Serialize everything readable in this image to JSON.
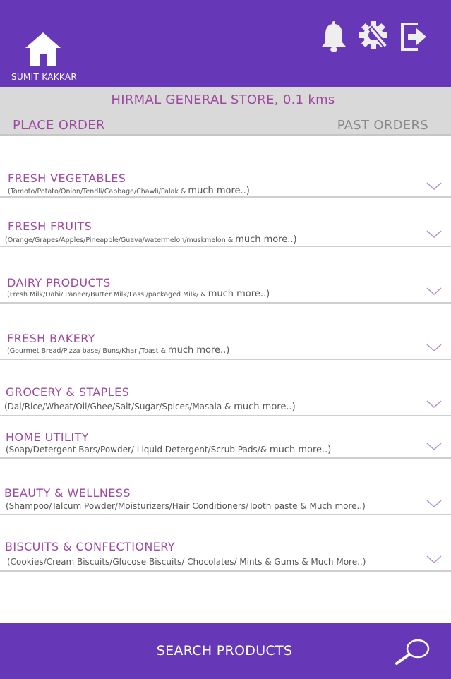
{
  "header": {
    "username": "SUMIT KAKKAR",
    "icons": {
      "home": "home-icon",
      "bell": "bell-icon",
      "settings": "gear-icon",
      "logout": "logout-icon"
    },
    "bg_color": "#6638b8"
  },
  "store": {
    "name": "HIRMAL GENERAL STORE, 0.1 kms",
    "tabs": {
      "place_order": "PLACE ORDER",
      "past_orders": "PAST ORDERS"
    },
    "active_tab": "place_order"
  },
  "categories": [
    {
      "title": "FRESH VEGETABLES",
      "desc": "(Tomoto/Potato/Onion/Tendli/Cabbage/Chawli/Palak & ",
      "more": "much more..)"
    },
    {
      "title": "FRESH FRUITS",
      "desc": "(Orange/Grapes/Apples/Pineapple/Guava/watermelon/muskmelon & ",
      "more": "much more..)"
    },
    {
      "title": "DAIRY PRODUCTS",
      "desc": "(Fresh Milk/Dahi/ Paneer/Butter Milk/Lassi/packaged Milk/ & ",
      "more": "much more..)"
    },
    {
      "title": "FRESH BAKERY",
      "desc": "(Gourmet Bread/Pizza base/ Buns/Khari/Toast & ",
      "more": "much more..)"
    },
    {
      "title": "GROCERY & STAPLES",
      "desc": "(Dal/Rice/Wheat/Oil/Ghee/Salt/Sugar/Spices/Masala & ",
      "more": "much more..)"
    },
    {
      "title": "HOME UTILITY",
      "desc": "(Soap/Detergent Bars/Powder/ Liquid Detergent/Scrub Pads/& ",
      "more": "much more..)"
    },
    {
      "title": "BEAUTY & WELLNESS",
      "desc": "(Shampoo/Talcum Powder/Moisturizers/Hair Conditioners/Tooth paste & Much more..)",
      "more": ""
    },
    {
      "title": "BISCUITS & CONFECTIONERY",
      "desc": "(Cookies/Cream Biscuits/Glucose Biscuits/ Chocolates/ Mints & Gums & Much More..)",
      "more": ""
    }
  ],
  "footer": {
    "search_label": "SEARCH PRODUCTS",
    "icon": "search-icon"
  },
  "colors": {
    "accent": "#9d4a9f",
    "tab_inactive": "#8a8a8a",
    "store_bar": "#d9d9d9"
  }
}
